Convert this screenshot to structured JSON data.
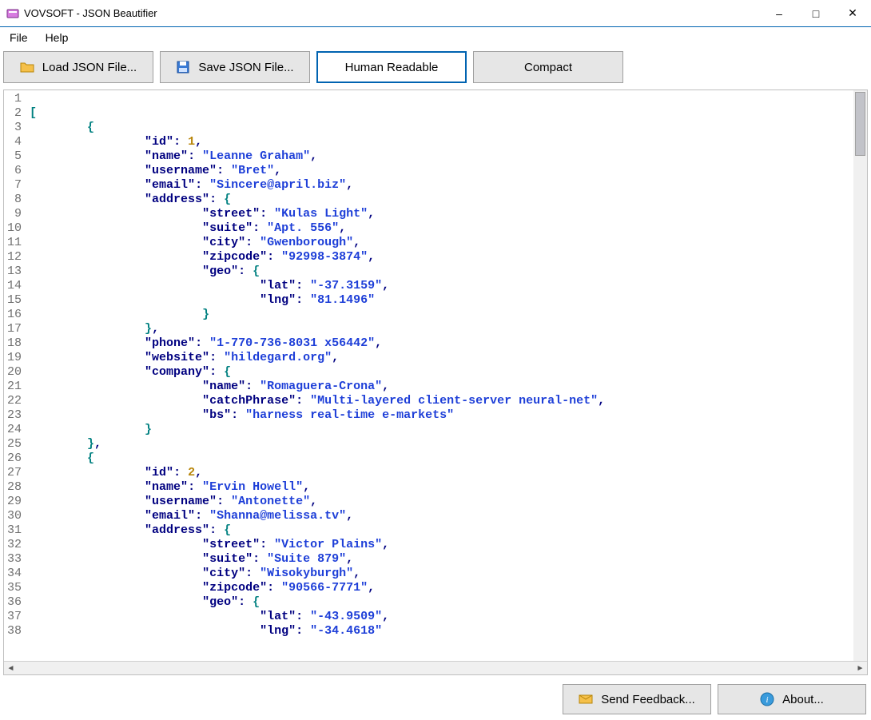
{
  "window": {
    "title": "VOVSOFT - JSON Beautifier"
  },
  "menu": {
    "file": "File",
    "help": "Help"
  },
  "toolbar": {
    "load": "Load JSON File...",
    "save": "Save JSON File...",
    "human": "Human Readable",
    "compact": "Compact"
  },
  "footer": {
    "feedback": "Send Feedback...",
    "about": "About..."
  },
  "editor": {
    "lines": [
      {
        "n": 1,
        "tokens": []
      },
      {
        "n": 2,
        "tokens": [
          {
            "t": "[",
            "c": "bracket"
          }
        ]
      },
      {
        "n": 3,
        "tokens": [
          {
            "t": "        ",
            "c": ""
          },
          {
            "t": "{",
            "c": "brace"
          }
        ]
      },
      {
        "n": 4,
        "tokens": [
          {
            "t": "                ",
            "c": ""
          },
          {
            "t": "\"id\"",
            "c": "key"
          },
          {
            "t": ": ",
            "c": "colon"
          },
          {
            "t": "1",
            "c": "num"
          },
          {
            "t": ",",
            "c": "comma"
          }
        ]
      },
      {
        "n": 5,
        "tokens": [
          {
            "t": "                ",
            "c": ""
          },
          {
            "t": "\"name\"",
            "c": "key"
          },
          {
            "t": ": ",
            "c": "colon"
          },
          {
            "t": "\"Leanne Graham\"",
            "c": "str"
          },
          {
            "t": ",",
            "c": "comma"
          }
        ]
      },
      {
        "n": 6,
        "tokens": [
          {
            "t": "                ",
            "c": ""
          },
          {
            "t": "\"username\"",
            "c": "key"
          },
          {
            "t": ": ",
            "c": "colon"
          },
          {
            "t": "\"Bret\"",
            "c": "str"
          },
          {
            "t": ",",
            "c": "comma"
          }
        ]
      },
      {
        "n": 7,
        "tokens": [
          {
            "t": "                ",
            "c": ""
          },
          {
            "t": "\"email\"",
            "c": "key"
          },
          {
            "t": ": ",
            "c": "colon"
          },
          {
            "t": "\"Sincere@april.biz\"",
            "c": "str"
          },
          {
            "t": ",",
            "c": "comma"
          }
        ]
      },
      {
        "n": 8,
        "tokens": [
          {
            "t": "                ",
            "c": ""
          },
          {
            "t": "\"address\"",
            "c": "key"
          },
          {
            "t": ": ",
            "c": "colon"
          },
          {
            "t": "{",
            "c": "brace"
          }
        ]
      },
      {
        "n": 9,
        "tokens": [
          {
            "t": "                        ",
            "c": ""
          },
          {
            "t": "\"street\"",
            "c": "key"
          },
          {
            "t": ": ",
            "c": "colon"
          },
          {
            "t": "\"Kulas Light\"",
            "c": "str"
          },
          {
            "t": ",",
            "c": "comma"
          }
        ]
      },
      {
        "n": 10,
        "tokens": [
          {
            "t": "                        ",
            "c": ""
          },
          {
            "t": "\"suite\"",
            "c": "key"
          },
          {
            "t": ": ",
            "c": "colon"
          },
          {
            "t": "\"Apt. 556\"",
            "c": "str"
          },
          {
            "t": ",",
            "c": "comma"
          }
        ]
      },
      {
        "n": 11,
        "tokens": [
          {
            "t": "                        ",
            "c": ""
          },
          {
            "t": "\"city\"",
            "c": "key"
          },
          {
            "t": ": ",
            "c": "colon"
          },
          {
            "t": "\"Gwenborough\"",
            "c": "str"
          },
          {
            "t": ",",
            "c": "comma"
          }
        ]
      },
      {
        "n": 12,
        "tokens": [
          {
            "t": "                        ",
            "c": ""
          },
          {
            "t": "\"zipcode\"",
            "c": "key"
          },
          {
            "t": ": ",
            "c": "colon"
          },
          {
            "t": "\"92998-3874\"",
            "c": "str"
          },
          {
            "t": ",",
            "c": "comma"
          }
        ]
      },
      {
        "n": 13,
        "tokens": [
          {
            "t": "                        ",
            "c": ""
          },
          {
            "t": "\"geo\"",
            "c": "key"
          },
          {
            "t": ": ",
            "c": "colon"
          },
          {
            "t": "{",
            "c": "brace"
          }
        ]
      },
      {
        "n": 14,
        "tokens": [
          {
            "t": "                                ",
            "c": ""
          },
          {
            "t": "\"lat\"",
            "c": "key"
          },
          {
            "t": ": ",
            "c": "colon"
          },
          {
            "t": "\"-37.3159\"",
            "c": "str"
          },
          {
            "t": ",",
            "c": "comma"
          }
        ]
      },
      {
        "n": 15,
        "tokens": [
          {
            "t": "                                ",
            "c": ""
          },
          {
            "t": "\"lng\"",
            "c": "key"
          },
          {
            "t": ": ",
            "c": "colon"
          },
          {
            "t": "\"81.1496\"",
            "c": "str"
          }
        ]
      },
      {
        "n": 16,
        "tokens": [
          {
            "t": "                        ",
            "c": ""
          },
          {
            "t": "}",
            "c": "brace"
          }
        ]
      },
      {
        "n": 17,
        "tokens": [
          {
            "t": "                ",
            "c": ""
          },
          {
            "t": "}",
            "c": "brace"
          },
          {
            "t": ",",
            "c": "comma"
          }
        ]
      },
      {
        "n": 18,
        "tokens": [
          {
            "t": "                ",
            "c": ""
          },
          {
            "t": "\"phone\"",
            "c": "key"
          },
          {
            "t": ": ",
            "c": "colon"
          },
          {
            "t": "\"1-770-736-8031 x56442\"",
            "c": "str"
          },
          {
            "t": ",",
            "c": "comma"
          }
        ]
      },
      {
        "n": 19,
        "tokens": [
          {
            "t": "                ",
            "c": ""
          },
          {
            "t": "\"website\"",
            "c": "key"
          },
          {
            "t": ": ",
            "c": "colon"
          },
          {
            "t": "\"hildegard.org\"",
            "c": "str"
          },
          {
            "t": ",",
            "c": "comma"
          }
        ]
      },
      {
        "n": 20,
        "tokens": [
          {
            "t": "                ",
            "c": ""
          },
          {
            "t": "\"company\"",
            "c": "key"
          },
          {
            "t": ": ",
            "c": "colon"
          },
          {
            "t": "{",
            "c": "brace"
          }
        ]
      },
      {
        "n": 21,
        "tokens": [
          {
            "t": "                        ",
            "c": ""
          },
          {
            "t": "\"name\"",
            "c": "key"
          },
          {
            "t": ": ",
            "c": "colon"
          },
          {
            "t": "\"Romaguera-Crona\"",
            "c": "str"
          },
          {
            "t": ",",
            "c": "comma"
          }
        ]
      },
      {
        "n": 22,
        "tokens": [
          {
            "t": "                        ",
            "c": ""
          },
          {
            "t": "\"catchPhrase\"",
            "c": "key"
          },
          {
            "t": ": ",
            "c": "colon"
          },
          {
            "t": "\"Multi-layered client-server neural-net\"",
            "c": "str"
          },
          {
            "t": ",",
            "c": "comma"
          }
        ]
      },
      {
        "n": 23,
        "tokens": [
          {
            "t": "                        ",
            "c": ""
          },
          {
            "t": "\"bs\"",
            "c": "key"
          },
          {
            "t": ": ",
            "c": "colon"
          },
          {
            "t": "\"harness real-time e-markets\"",
            "c": "str"
          }
        ]
      },
      {
        "n": 24,
        "tokens": [
          {
            "t": "                ",
            "c": ""
          },
          {
            "t": "}",
            "c": "brace"
          }
        ]
      },
      {
        "n": 25,
        "tokens": [
          {
            "t": "        ",
            "c": ""
          },
          {
            "t": "}",
            "c": "brace"
          },
          {
            "t": ",",
            "c": "comma"
          }
        ]
      },
      {
        "n": 26,
        "tokens": [
          {
            "t": "        ",
            "c": ""
          },
          {
            "t": "{",
            "c": "brace"
          }
        ]
      },
      {
        "n": 27,
        "tokens": [
          {
            "t": "                ",
            "c": ""
          },
          {
            "t": "\"id\"",
            "c": "key"
          },
          {
            "t": ": ",
            "c": "colon"
          },
          {
            "t": "2",
            "c": "num"
          },
          {
            "t": ",",
            "c": "comma"
          }
        ]
      },
      {
        "n": 28,
        "tokens": [
          {
            "t": "                ",
            "c": ""
          },
          {
            "t": "\"name\"",
            "c": "key"
          },
          {
            "t": ": ",
            "c": "colon"
          },
          {
            "t": "\"Ervin Howell\"",
            "c": "str"
          },
          {
            "t": ",",
            "c": "comma"
          }
        ]
      },
      {
        "n": 29,
        "tokens": [
          {
            "t": "                ",
            "c": ""
          },
          {
            "t": "\"username\"",
            "c": "key"
          },
          {
            "t": ": ",
            "c": "colon"
          },
          {
            "t": "\"Antonette\"",
            "c": "str"
          },
          {
            "t": ",",
            "c": "comma"
          }
        ]
      },
      {
        "n": 30,
        "tokens": [
          {
            "t": "                ",
            "c": ""
          },
          {
            "t": "\"email\"",
            "c": "key"
          },
          {
            "t": ": ",
            "c": "colon"
          },
          {
            "t": "\"Shanna@melissa.tv\"",
            "c": "str"
          },
          {
            "t": ",",
            "c": "comma"
          }
        ]
      },
      {
        "n": 31,
        "tokens": [
          {
            "t": "                ",
            "c": ""
          },
          {
            "t": "\"address\"",
            "c": "key"
          },
          {
            "t": ": ",
            "c": "colon"
          },
          {
            "t": "{",
            "c": "brace"
          }
        ]
      },
      {
        "n": 32,
        "tokens": [
          {
            "t": "                        ",
            "c": ""
          },
          {
            "t": "\"street\"",
            "c": "key"
          },
          {
            "t": ": ",
            "c": "colon"
          },
          {
            "t": "\"Victor Plains\"",
            "c": "str"
          },
          {
            "t": ",",
            "c": "comma"
          }
        ]
      },
      {
        "n": 33,
        "tokens": [
          {
            "t": "                        ",
            "c": ""
          },
          {
            "t": "\"suite\"",
            "c": "key"
          },
          {
            "t": ": ",
            "c": "colon"
          },
          {
            "t": "\"Suite 879\"",
            "c": "str"
          },
          {
            "t": ",",
            "c": "comma"
          }
        ]
      },
      {
        "n": 34,
        "tokens": [
          {
            "t": "                        ",
            "c": ""
          },
          {
            "t": "\"city\"",
            "c": "key"
          },
          {
            "t": ": ",
            "c": "colon"
          },
          {
            "t": "\"Wisokyburgh\"",
            "c": "str"
          },
          {
            "t": ",",
            "c": "comma"
          }
        ]
      },
      {
        "n": 35,
        "tokens": [
          {
            "t": "                        ",
            "c": ""
          },
          {
            "t": "\"zipcode\"",
            "c": "key"
          },
          {
            "t": ": ",
            "c": "colon"
          },
          {
            "t": "\"90566-7771\"",
            "c": "str"
          },
          {
            "t": ",",
            "c": "comma"
          }
        ]
      },
      {
        "n": 36,
        "tokens": [
          {
            "t": "                        ",
            "c": ""
          },
          {
            "t": "\"geo\"",
            "c": "key"
          },
          {
            "t": ": ",
            "c": "colon"
          },
          {
            "t": "{",
            "c": "brace"
          }
        ]
      },
      {
        "n": 37,
        "tokens": [
          {
            "t": "                                ",
            "c": ""
          },
          {
            "t": "\"lat\"",
            "c": "key"
          },
          {
            "t": ": ",
            "c": "colon"
          },
          {
            "t": "\"-43.9509\"",
            "c": "str"
          },
          {
            "t": ",",
            "c": "comma"
          }
        ]
      },
      {
        "n": 38,
        "tokens": [
          {
            "t": "                                ",
            "c": ""
          },
          {
            "t": "\"lng\"",
            "c": "key"
          },
          {
            "t": ": ",
            "c": "colon"
          },
          {
            "t": "\"-34.4618\"",
            "c": "str"
          }
        ]
      }
    ]
  }
}
